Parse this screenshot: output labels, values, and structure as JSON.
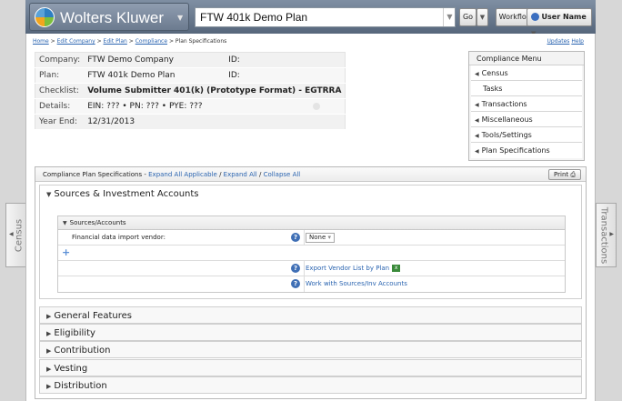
{
  "header": {
    "logo_text": "Wolters Kluwer",
    "plan_value": "FTW 401k Demo Plan",
    "go_label": "Go",
    "workflow_label": "Workflow",
    "user_label": "User Name"
  },
  "breadcrumb": {
    "home": "Home",
    "edit_company": "Edit Company",
    "edit_plan": "Edit Plan",
    "compliance": "Compliance",
    "current": "Plan Specifications",
    "sep": ">"
  },
  "top_links": {
    "updates": "Updates",
    "help": "Help"
  },
  "info": [
    {
      "key": "Company:",
      "value": "FTW Demo Company",
      "id_key": "ID:",
      "id_value": ""
    },
    {
      "key": "Plan:",
      "value": "FTW 401k Demo Plan",
      "id_key": "ID:",
      "id_value": ""
    },
    {
      "key": "Checklist:",
      "value": "Volume Submitter 401(k) (Prototype Format) - EGTRRA"
    },
    {
      "key": "Details:",
      "value": "EIN: ??? • PN: ??? • PYE: ???"
    },
    {
      "key": "Year End:",
      "value": "12/31/2013"
    }
  ],
  "compliance_menu": {
    "title": "Compliance Menu",
    "items": [
      "Census",
      "Tasks",
      "Transactions",
      "Miscellaneous",
      "Tools/Settings",
      "Plan Specifications"
    ]
  },
  "spec": {
    "title": "Compliance Plan Specifications -",
    "expand_applicable": "Expand All Applicable",
    "expand_all": "Expand All",
    "collapse_all": "Collapse All",
    "slash": "/",
    "print_label": "Print",
    "sections": [
      "Sources & Investment Accounts",
      "General Features",
      "Eligibility",
      "Contribution",
      "Vesting",
      "Distribution"
    ],
    "subsection_title": "Sources/Accounts",
    "vendor_label": "Financial data import vendor:",
    "vendor_value": "None",
    "add_symbol": "+",
    "export_link": "Export Vendor List by Plan",
    "work_link": "Work with Sources/Inv Accounts"
  },
  "side_tabs": {
    "left": "Census",
    "right": "Transactions"
  }
}
